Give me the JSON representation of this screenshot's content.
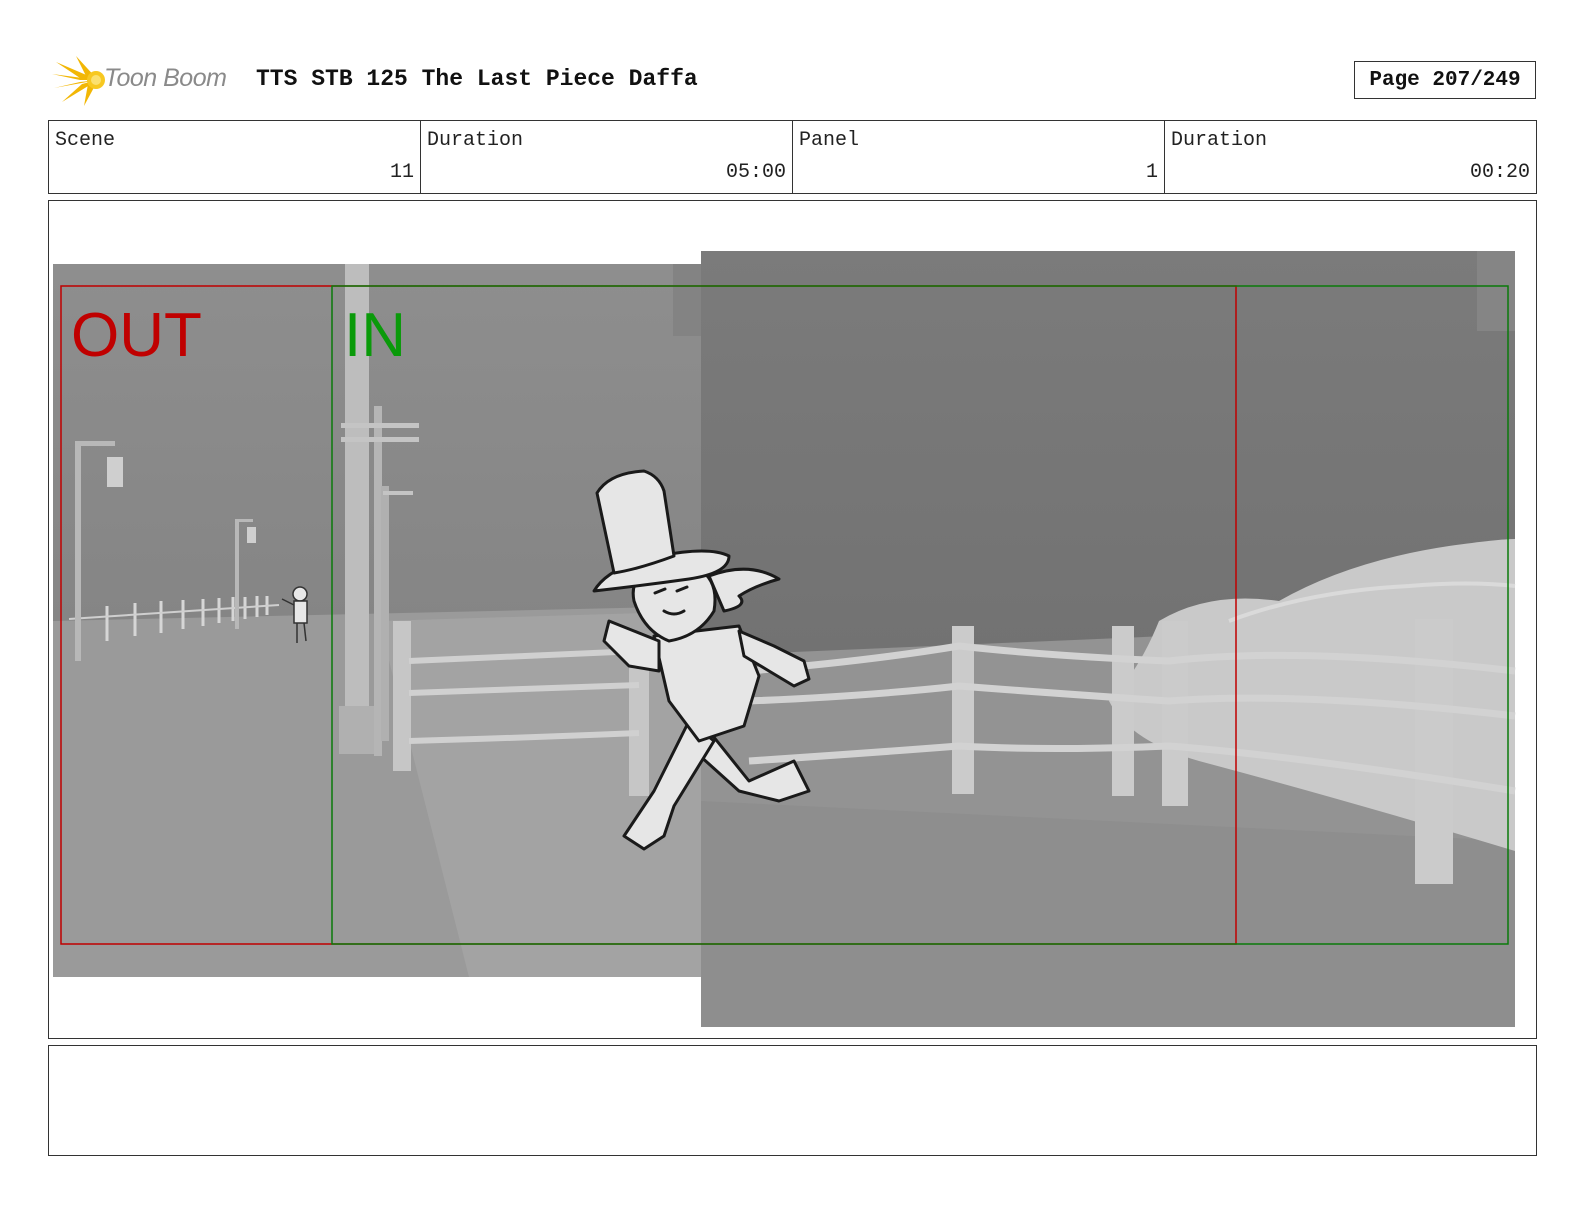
{
  "header": {
    "logo_text": "Toon Boom",
    "title": "TTS STB 125 The Last Piece Daffa",
    "page": "Page 207/249"
  },
  "info": {
    "scene_label": "Scene",
    "scene_value": "11",
    "scene_duration_label": "Duration",
    "scene_duration_value": "05:00",
    "panel_label": "Panel",
    "panel_value": "1",
    "panel_duration_label": "Duration",
    "panel_duration_value": "00:20"
  },
  "panel_image": {
    "out_label": "OUT",
    "in_label": "IN",
    "out_color": "#c00000",
    "in_color": "#0a9a0a"
  },
  "notes": {
    "text": ""
  }
}
